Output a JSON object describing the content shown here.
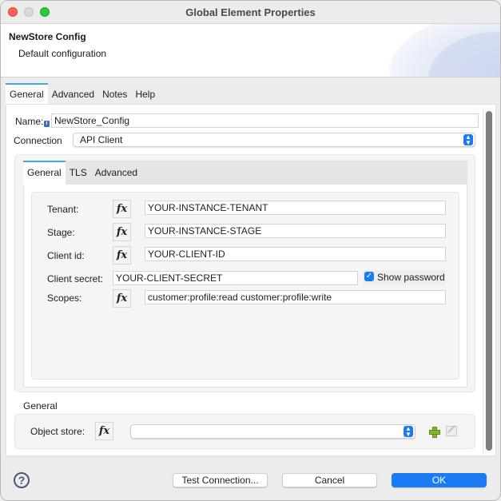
{
  "window": {
    "title": "Global Element Properties",
    "controls": [
      "close",
      "minimize",
      "maximize"
    ]
  },
  "banner": {
    "title": "NewStore Config",
    "description": "Default configuration"
  },
  "top_tabs": [
    {
      "label": "General",
      "active": true
    },
    {
      "label": "Advanced",
      "active": false
    },
    {
      "label": "Notes",
      "active": false
    },
    {
      "label": "Help",
      "active": false
    }
  ],
  "name_field": {
    "label": "Name:",
    "value": "NewStore_Config",
    "info_icon": "i"
  },
  "connection": {
    "label": "Connection",
    "value": "API Client",
    "arrows": "⌃⌄"
  },
  "sub_tabs": [
    {
      "label": "General",
      "active": true
    },
    {
      "label": "TLS",
      "active": false
    },
    {
      "label": "Advanced",
      "active": false
    }
  ],
  "fields": {
    "fx_label": "fx",
    "tenant": {
      "label": "Tenant:",
      "value": "YOUR-INSTANCE-TENANT"
    },
    "stage": {
      "label": "Stage:",
      "value": "YOUR-INSTANCE-STAGE"
    },
    "client_id": {
      "label": "Client id:",
      "value": "YOUR-CLIENT-ID"
    },
    "client_secret": {
      "label": "Client secret:",
      "value": "YOUR-CLIENT-SECRET"
    },
    "show_password": {
      "label": "Show password",
      "checked": true,
      "check_glyph": "✓"
    },
    "scopes": {
      "label": "Scopes:",
      "value": "customer:profile:read customer:profile:write"
    }
  },
  "general_section": {
    "title": "General",
    "object_store": {
      "label": "Object store:",
      "value": "",
      "arrows": "⌃⌄"
    }
  },
  "footer": {
    "help_glyph": "?",
    "test_connection": "Test Connection...",
    "cancel": "Cancel",
    "ok": "OK"
  },
  "colors": {
    "accent": "#1a7bf2",
    "tab_indicator": "#4aa8d8",
    "add_icon": "#86b92a"
  }
}
